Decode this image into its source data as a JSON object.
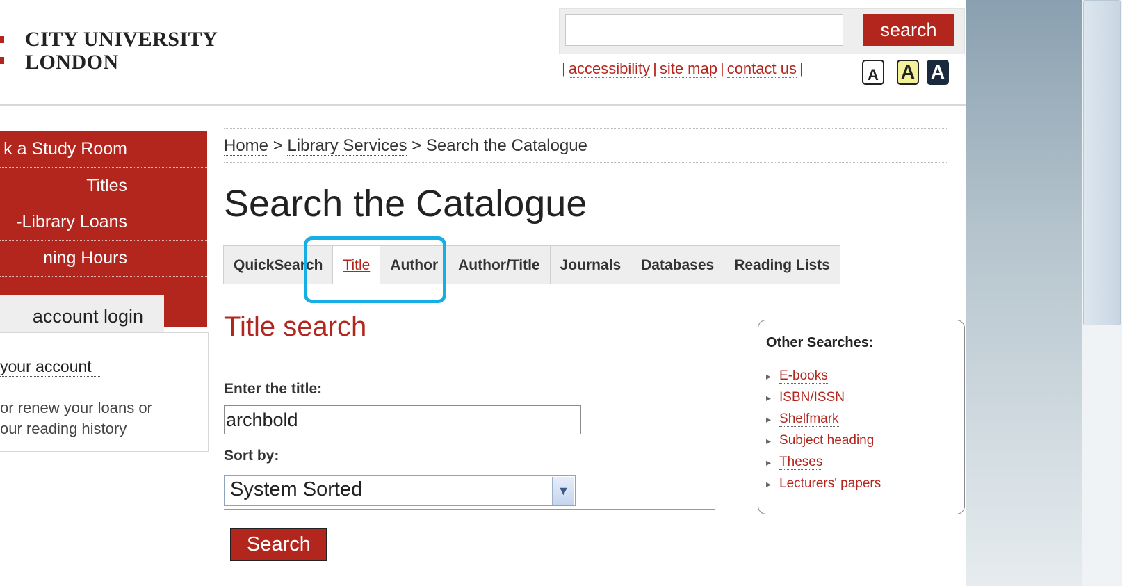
{
  "header": {
    "logo_line1": "CITY UNIVERSITY",
    "logo_line2": "LONDON",
    "search_button": "search",
    "search_placeholder": "",
    "links": [
      "accessibility",
      "site map",
      "contact us"
    ],
    "font_size_buttons": [
      "A",
      "A",
      "A"
    ]
  },
  "sidebar": {
    "items": [
      "k a Study Room",
      "Titles",
      "-Library Loans",
      "ning Hours"
    ],
    "login_tab": "account login",
    "login_link": "your account",
    "login_desc": "or renew your loans or our reading history"
  },
  "breadcrumb": [
    "Home",
    "Library Services",
    "Search the Catalogue"
  ],
  "breadcrumb_sep": ">",
  "page_title": "Search the Catalogue",
  "tabs": [
    "QuickSearch",
    "Title",
    "Author",
    "Author/Title",
    "Journals",
    "Databases",
    "Reading Lists"
  ],
  "active_tab": "Title",
  "form": {
    "title": "Title search",
    "title_label": "Enter the title:",
    "title_value": "archbold",
    "sort_label": "Sort by:",
    "sort_value": "System Sorted",
    "search_button": "Search"
  },
  "other_searches": {
    "title": "Other Searches:",
    "items": [
      "E-books",
      "ISBN/ISSN",
      "Shelfmark",
      "Subject heading",
      "Theses",
      "Lecturers' papers"
    ]
  },
  "colors": {
    "brand_red": "#b3261e",
    "highlight": "#15aee5"
  }
}
